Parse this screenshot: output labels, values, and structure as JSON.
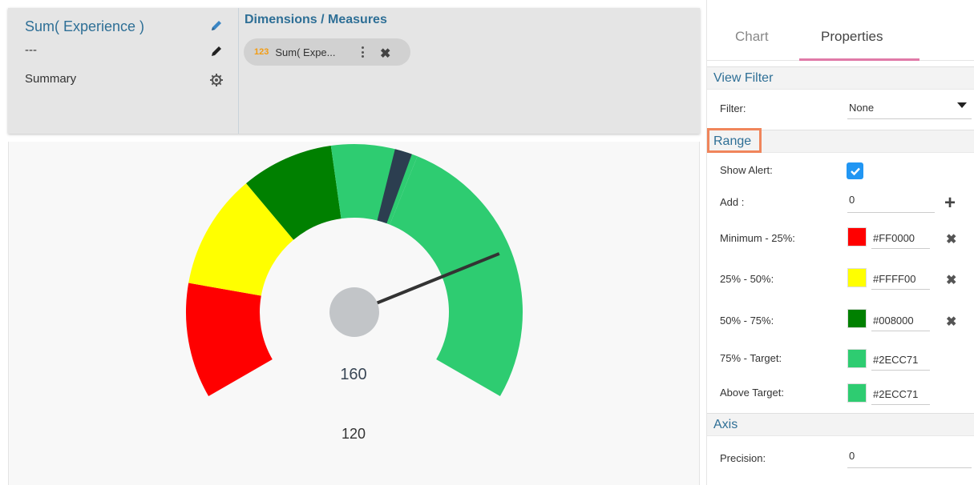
{
  "measure_panel": {
    "measure_title": "Sum( Experience )",
    "measure_sub": "---",
    "summary_label": "Summary"
  },
  "dimensions": {
    "title": "Dimensions / Measures",
    "pill": {
      "type_badge": "123",
      "label": "Sum( Expe..."
    }
  },
  "gauge": {
    "value_label": "160",
    "target_label": "120",
    "value": 160,
    "target": 120,
    "bands": [
      {
        "name": "Minimum - 25%",
        "color": "#FF0000"
      },
      {
        "name": "25% - 50%",
        "color": "#FFFF00"
      },
      {
        "name": "50% - 75%",
        "color": "#008000"
      },
      {
        "name": "75% - Target",
        "color": "#2ECC71"
      },
      {
        "name": "Above Target",
        "color": "#2ECC71"
      }
    ]
  },
  "tabs": [
    {
      "label": "Chart",
      "active": false
    },
    {
      "label": "Properties",
      "active": true
    }
  ],
  "view_filter": {
    "section_title": "View Filter",
    "filter_label": "Filter:",
    "filter_value": "None"
  },
  "range": {
    "section_title": "Range",
    "show_alert_label": "Show Alert:",
    "show_alert": true,
    "add_label": "Add :",
    "add_value": "0",
    "rows": [
      {
        "label": "Minimum - 25%:",
        "hex": "#FF0000",
        "color": "#FF0000",
        "removable": true
      },
      {
        "label": "25% - 50%:",
        "hex": "#FFFF00",
        "color": "#FFFF00",
        "removable": true
      },
      {
        "label": "50% - 75%:",
        "hex": "#008000",
        "color": "#008000",
        "removable": true
      },
      {
        "label": "75% - Target:",
        "hex": "#2ECC71",
        "color": "#2ECC71",
        "removable": false
      },
      {
        "label": "Above Target:",
        "hex": "#2ECC71",
        "color": "#2ECC71",
        "removable": false
      }
    ]
  },
  "axis": {
    "section_title": "Axis",
    "precision_label": "Precision:",
    "precision_value": "0"
  },
  "icons": {
    "measure_edit": "pencil-icon",
    "sub_edit": "pencil-icon",
    "summary_settings": "gear-icon",
    "pill_menu": "kebab-menu-icon",
    "pill_remove": "close-icon",
    "filter_dropdown": "caret-down-icon",
    "add_range": "plus-icon",
    "remove_range": "close-icon"
  },
  "colors": {
    "accent_blue": "#2E6F96",
    "tab_underline": "#E07AA8",
    "highlight_box": "#F0855B",
    "checkbox": "#2196F3",
    "needle_hub": "#C2C5C8",
    "marker": "#2C3E50"
  }
}
